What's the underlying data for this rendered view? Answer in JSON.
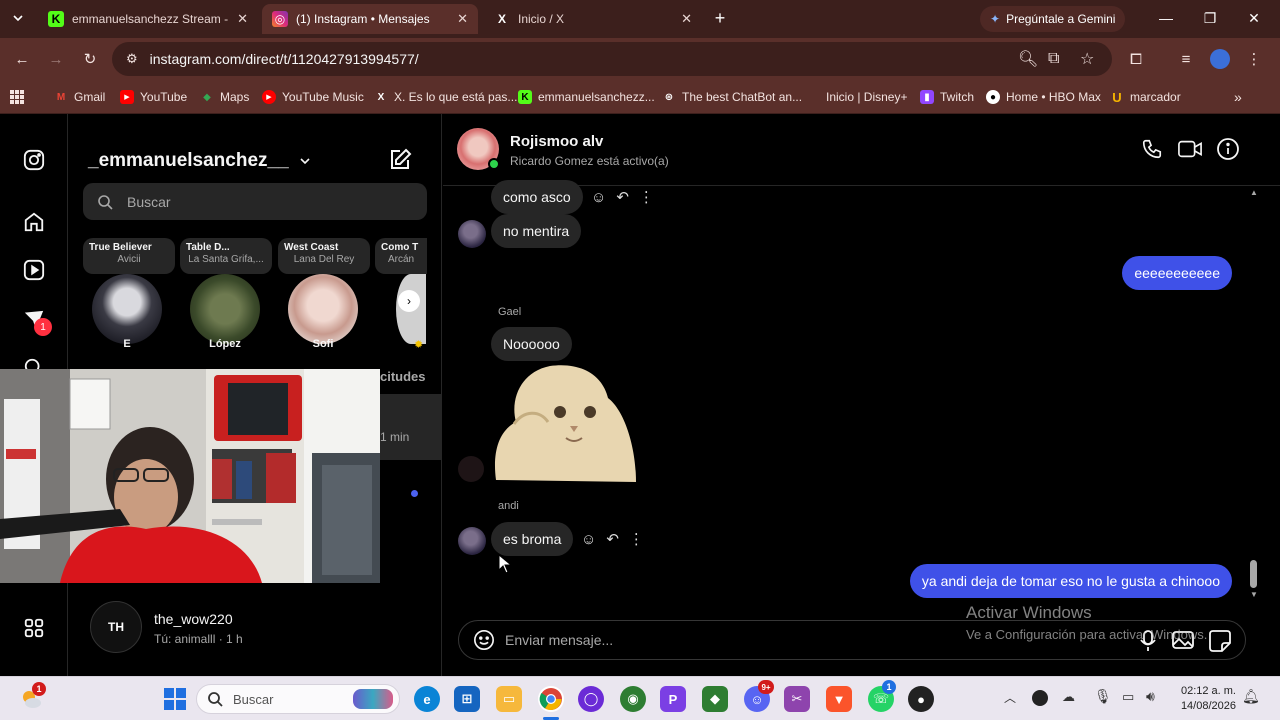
{
  "browser": {
    "tabs": [
      {
        "label": "emmanuelsanchezz Stream - W",
        "icon": "kick-icon"
      },
      {
        "label": "(1) Instagram • Mensajes",
        "icon": "instagram-icon"
      },
      {
        "label": "Inicio / X",
        "icon": "x-icon"
      }
    ],
    "gemini_label": "Pregúntale a Gemini",
    "url": "instagram.com/direct/t/1120427913994577/",
    "bookmarks": [
      {
        "label": "Gmail",
        "icon": "gmail-icon"
      },
      {
        "label": "YouTube",
        "icon": "youtube-icon"
      },
      {
        "label": "Maps",
        "icon": "maps-icon"
      },
      {
        "label": "YouTube Music",
        "icon": "youtube-music-icon"
      },
      {
        "label": "X. Es lo que está pas...",
        "icon": "x-icon"
      },
      {
        "label": "emmanuelsanchezz...",
        "icon": "kick-icon"
      },
      {
        "label": "The best ChatBot an...",
        "icon": "chatbot-icon"
      },
      {
        "label": "Inicio | Disney+",
        "icon": "disney-icon"
      },
      {
        "label": "Twitch",
        "icon": "twitch-icon"
      },
      {
        "label": "Home • HBO Max",
        "icon": "hbo-icon"
      },
      {
        "label": "marcador",
        "icon": "bookmark-u-icon"
      }
    ]
  },
  "sidebar": {
    "username": "_emmanuelsanchez__",
    "search_placeholder": "Buscar",
    "notification_badge": "1",
    "notes": [
      {
        "title": "True Believer",
        "artist": "Avicii",
        "name": "E"
      },
      {
        "title": "Table D...",
        "artist": "La Santa Grifa,...",
        "name": "López"
      },
      {
        "title": "West Coast",
        "artist": "Lana Del Rey",
        "name": "Sofi"
      },
      {
        "title": "Como T",
        "artist": "Arcán",
        "name": ""
      }
    ],
    "requests_label_partial": "citudes",
    "partial_time": "1 min",
    "conversations": [
      {
        "name": "the_wow220",
        "preview": "Tú: animalll · 1 h"
      }
    ]
  },
  "chat": {
    "contact_name": "Rojismoo alv",
    "contact_status": "Ricardo Gomez está activo(a)",
    "messages": [
      {
        "type": "in",
        "text": "como asco"
      },
      {
        "type": "in",
        "text": "no mentira"
      },
      {
        "type": "out",
        "text": "eeeeeeeeeee"
      },
      {
        "type": "sender",
        "text": "Gael"
      },
      {
        "type": "in",
        "text": "Noooooo"
      },
      {
        "type": "sender",
        "text": "andi"
      },
      {
        "type": "in",
        "text": "es broma"
      },
      {
        "type": "out",
        "text": "ya andi deja de tomar eso no le gusta a chinooo"
      }
    ],
    "composer_placeholder": "Enviar mensaje..."
  },
  "watermark": {
    "title": "Activar Windows",
    "subtitle": "Ve a Configuración para activar Windows."
  },
  "taskbar": {
    "search_placeholder": "Buscar",
    "time": "02:12 a. m.",
    "date": "14/08/2026",
    "weather_badge": "1",
    "discord_badge": "9+",
    "whatsapp_badge": "1"
  },
  "colors": {
    "titlebar": "#3c1f1c",
    "toolbar": "#5a2f2a",
    "outgoing_bubble": "#3f51e8",
    "incoming_bubble": "#262626",
    "badge": "#ff3040"
  }
}
